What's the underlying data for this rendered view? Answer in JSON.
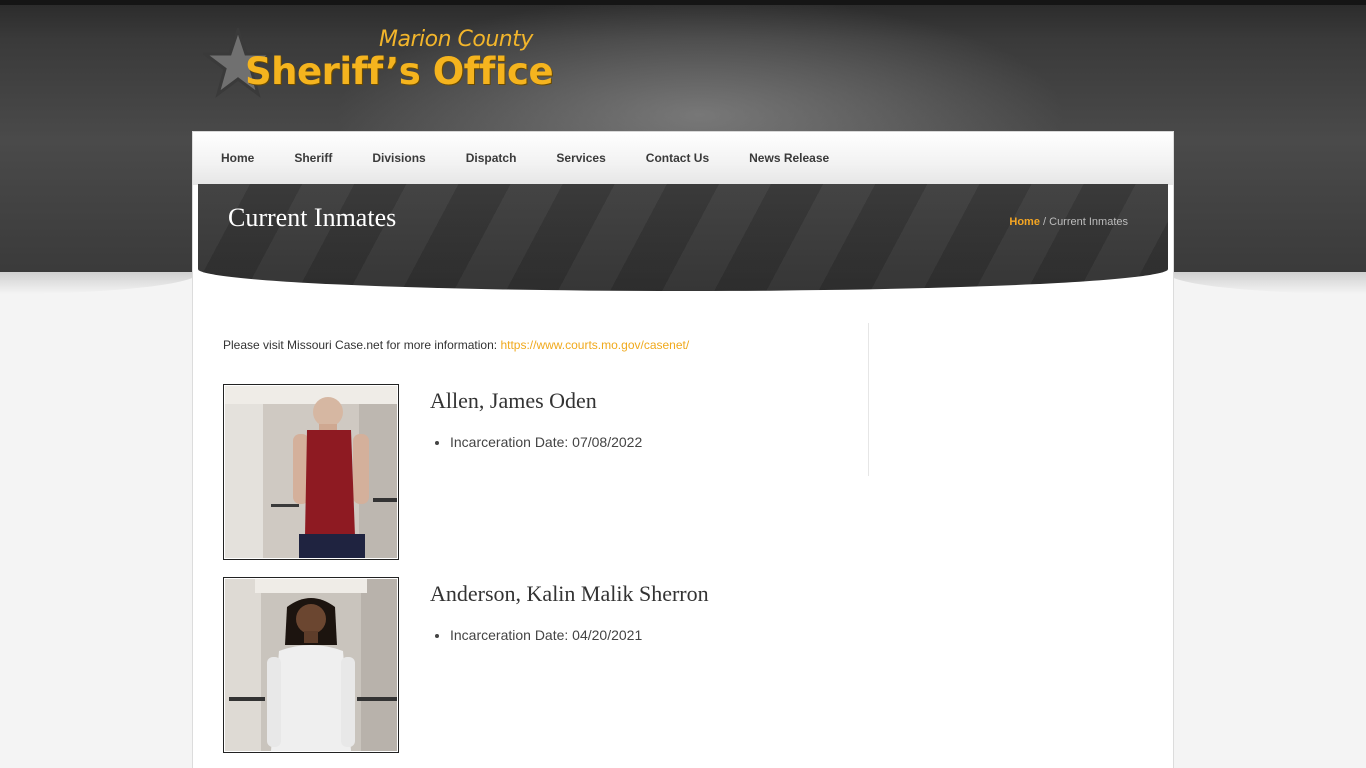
{
  "logo": {
    "county": "Marion County",
    "office": "Sheriff’s Office"
  },
  "nav": [
    "Home",
    "Sheriff",
    "Divisions",
    "Dispatch",
    "Services",
    "Contact Us",
    "News Release"
  ],
  "page": {
    "title": "Current Inmates",
    "breadcrumb": {
      "home": "Home",
      "separator": " / ",
      "current": "Current Inmates"
    }
  },
  "intro": {
    "text": "Please visit Missouri Case.net for more information: ",
    "link": "https://www.courts.mo.gov/casenet/"
  },
  "inmates": [
    {
      "name": "Allen, James Oden",
      "incarceration": "Incarceration Date: 07/08/2022"
    },
    {
      "name": "Anderson, Kalin Malik Sherron",
      "incarceration": "Incarceration Date: 04/20/2021"
    }
  ],
  "colors": {
    "accent": "#f5a623",
    "logo": "#f5b41e",
    "header": "#3a3a3a"
  }
}
